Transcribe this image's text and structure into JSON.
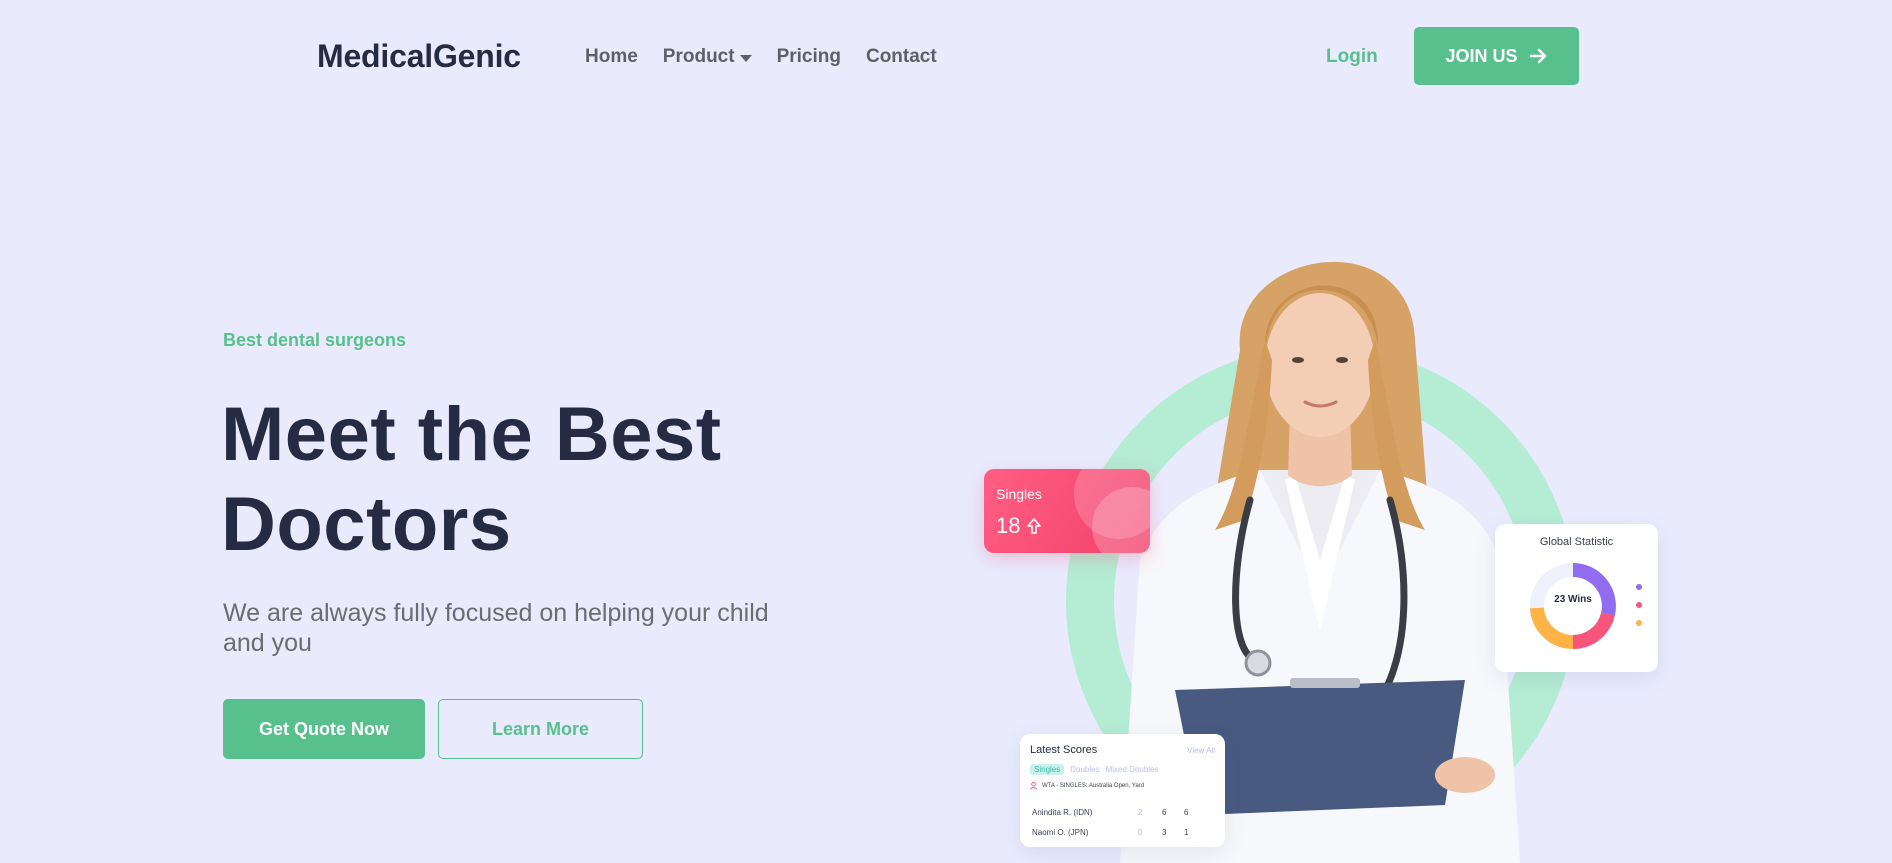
{
  "nav": {
    "brand": "MedicalGenic",
    "menu": [
      {
        "label": "Home"
      },
      {
        "label": "Product"
      },
      {
        "label": "Pricing"
      },
      {
        "label": "Contact"
      }
    ],
    "login": "Login",
    "join": "JOIN US"
  },
  "hero": {
    "tagline": "Best dental surgeons",
    "headline_line1": "Meet the Best",
    "headline_line2": "Doctors",
    "subtext": "We are always fully focused on helping your child and you",
    "primary_button": "Get Quote Now",
    "secondary_button": "Learn More"
  },
  "cards": {
    "singles": {
      "label": "Singles",
      "value": "18"
    },
    "stat": {
      "title": "Global Statistic",
      "center": "23 Wins"
    },
    "scores": {
      "title": "Latest Scores",
      "view_all": "View All",
      "tabs": [
        "Singles",
        "Doubles",
        "Mixed Doubles"
      ],
      "event": "WTA - SINGLES: Australia Open, Yard",
      "rows": [
        {
          "player": "Anindita R. (IDN)",
          "s1": "2",
          "s2": "6",
          "s3": "6"
        },
        {
          "player": "Naomi O. (JPN)",
          "s1": "0",
          "s2": "3",
          "s3": "1"
        }
      ]
    }
  },
  "colors": {
    "accent": "#58c08d",
    "background": "#e9ebfd",
    "heading": "#252b42",
    "ring": "#b4ecd4",
    "singles_card": "#f2406b"
  }
}
